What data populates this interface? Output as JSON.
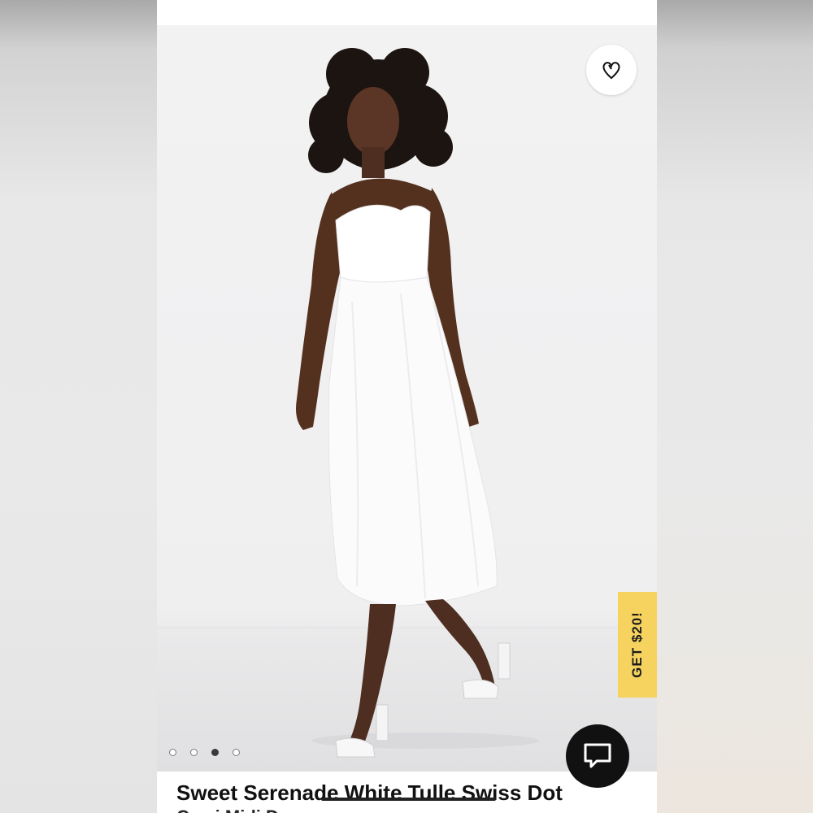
{
  "product": {
    "title": "Sweet Serenade White Tulle Swiss Dot",
    "subtitle_fragment": "Cami Midi Dress"
  },
  "promo": {
    "label": "GET $20!",
    "color": "#f6d35e"
  },
  "icons": {
    "favorite": "heart-icon",
    "chat": "chat-bubble-icon"
  },
  "carousel": {
    "total": 4,
    "active_index": 2
  }
}
